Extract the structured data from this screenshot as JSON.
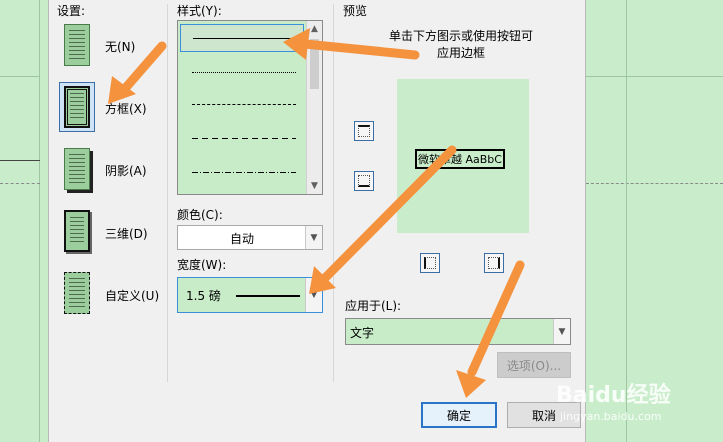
{
  "settings": {
    "title": "设置:",
    "items": [
      {
        "label": "无(N)"
      },
      {
        "label": "方框(X)"
      },
      {
        "label": "阴影(A)"
      },
      {
        "label": "三维(D)"
      },
      {
        "label": "自定义(U)"
      }
    ]
  },
  "style": {
    "title": "样式(Y):",
    "items": [
      "solid",
      "dotted",
      "dashed-small",
      "dashed-large",
      "dash-dot"
    ]
  },
  "color": {
    "title": "颜色(C):",
    "value": "自动"
  },
  "width": {
    "title": "宽度(W):",
    "value": "1.5 磅"
  },
  "preview": {
    "title": "预览",
    "hint_line1": "单击下方图示或使用按钮可",
    "hint_line2": "应用边框",
    "sample_text": "微软卓越 AaBbC"
  },
  "apply_to": {
    "title": "应用于(L):",
    "value": "文字"
  },
  "buttons": {
    "options": "选项(O)...",
    "ok": "确定",
    "cancel": "取消"
  },
  "watermark": {
    "brand": "Baidu经验",
    "url": "jingyan.baidu.com"
  },
  "colors": {
    "arrow": "#f5923e",
    "document_bg": "#c9edcb",
    "selection": "#3b8fd9"
  }
}
